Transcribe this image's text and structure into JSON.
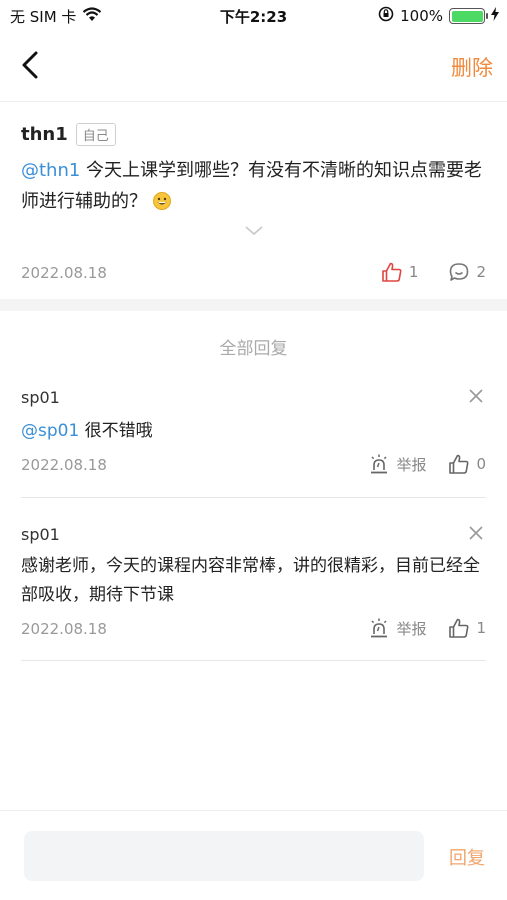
{
  "status_bar": {
    "carrier": "无 SIM 卡",
    "time": "下午2:23",
    "battery": "100%"
  },
  "nav": {
    "delete_label": "删除"
  },
  "post": {
    "author": "thn1",
    "badge": "自己",
    "mention": "@thn1",
    "text": " 今天上课学到哪些？有没有不清晰的知识点需要老师进行辅助的？",
    "date": "2022.08.18",
    "likes": "1",
    "comments": "2"
  },
  "section_title": "全部回复",
  "replies": [
    {
      "user": "sp01",
      "mention": "@sp01",
      "text": " 很不错哦",
      "date": "2022.08.18",
      "report_label": "举报",
      "likes": "0"
    },
    {
      "user": "sp01",
      "mention": "",
      "text": "感谢老师，今天的课程内容非常棒，讲的很精彩，目前已经全部吸收，期待下节课",
      "date": "2022.08.18",
      "report_label": "举报",
      "likes": "1"
    }
  ],
  "bottom": {
    "input_placeholder": "",
    "send_label": "回复"
  },
  "colors": {
    "accent": "#f08a3c",
    "mention": "#3a8fd6",
    "liked": "#e0443e"
  }
}
